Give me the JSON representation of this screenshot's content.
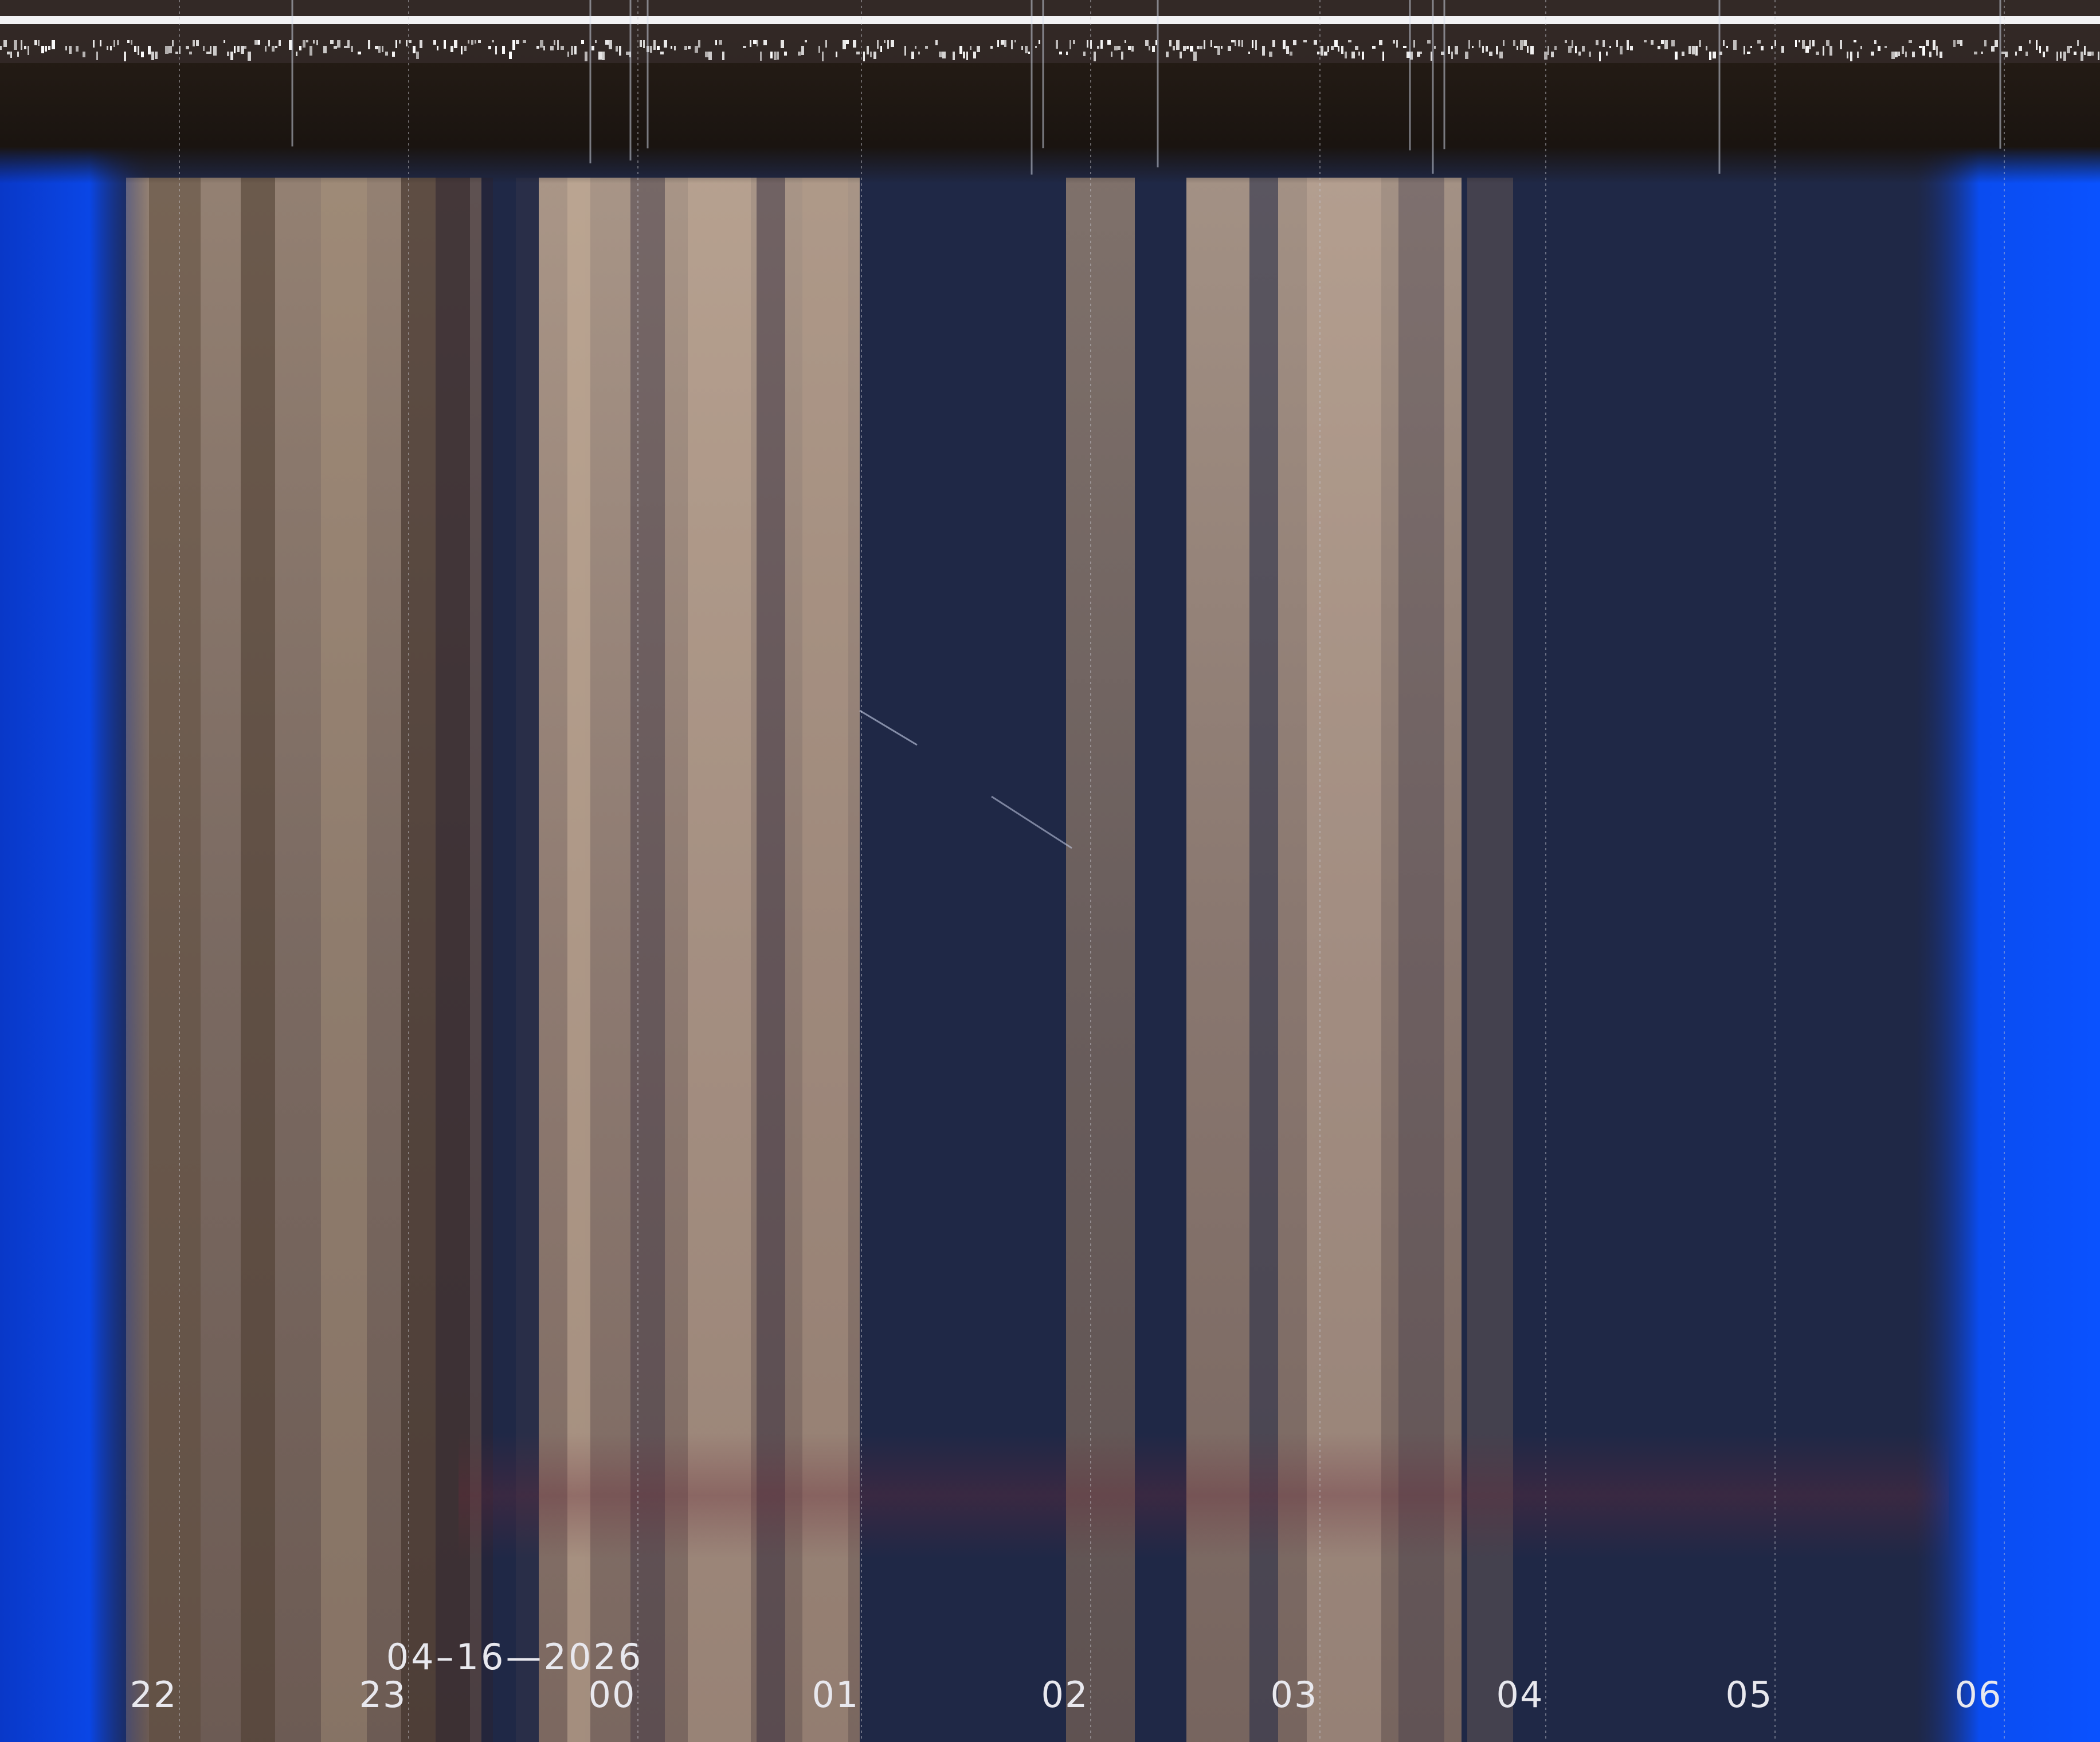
{
  "timeline": {
    "date": "04–16—2026",
    "hours": [
      {
        "label": "22",
        "hour": 22
      },
      {
        "label": "23",
        "hour": 23
      },
      {
        "label": "00",
        "hour": 0
      },
      {
        "label": "01",
        "hour": 1
      },
      {
        "label": "02",
        "hour": 2
      },
      {
        "label": "03",
        "hour": 3
      },
      {
        "label": "04",
        "hour": 4
      },
      {
        "label": "05",
        "hour": 5
      },
      {
        "label": "06",
        "hour": 6
      }
    ]
  },
  "colors": {
    "night_sky": "#1e2744",
    "cloud": "#9a8778",
    "twilight": "#0a46e6",
    "dark_band": "#1a1410",
    "label": "#e8e8ee"
  }
}
